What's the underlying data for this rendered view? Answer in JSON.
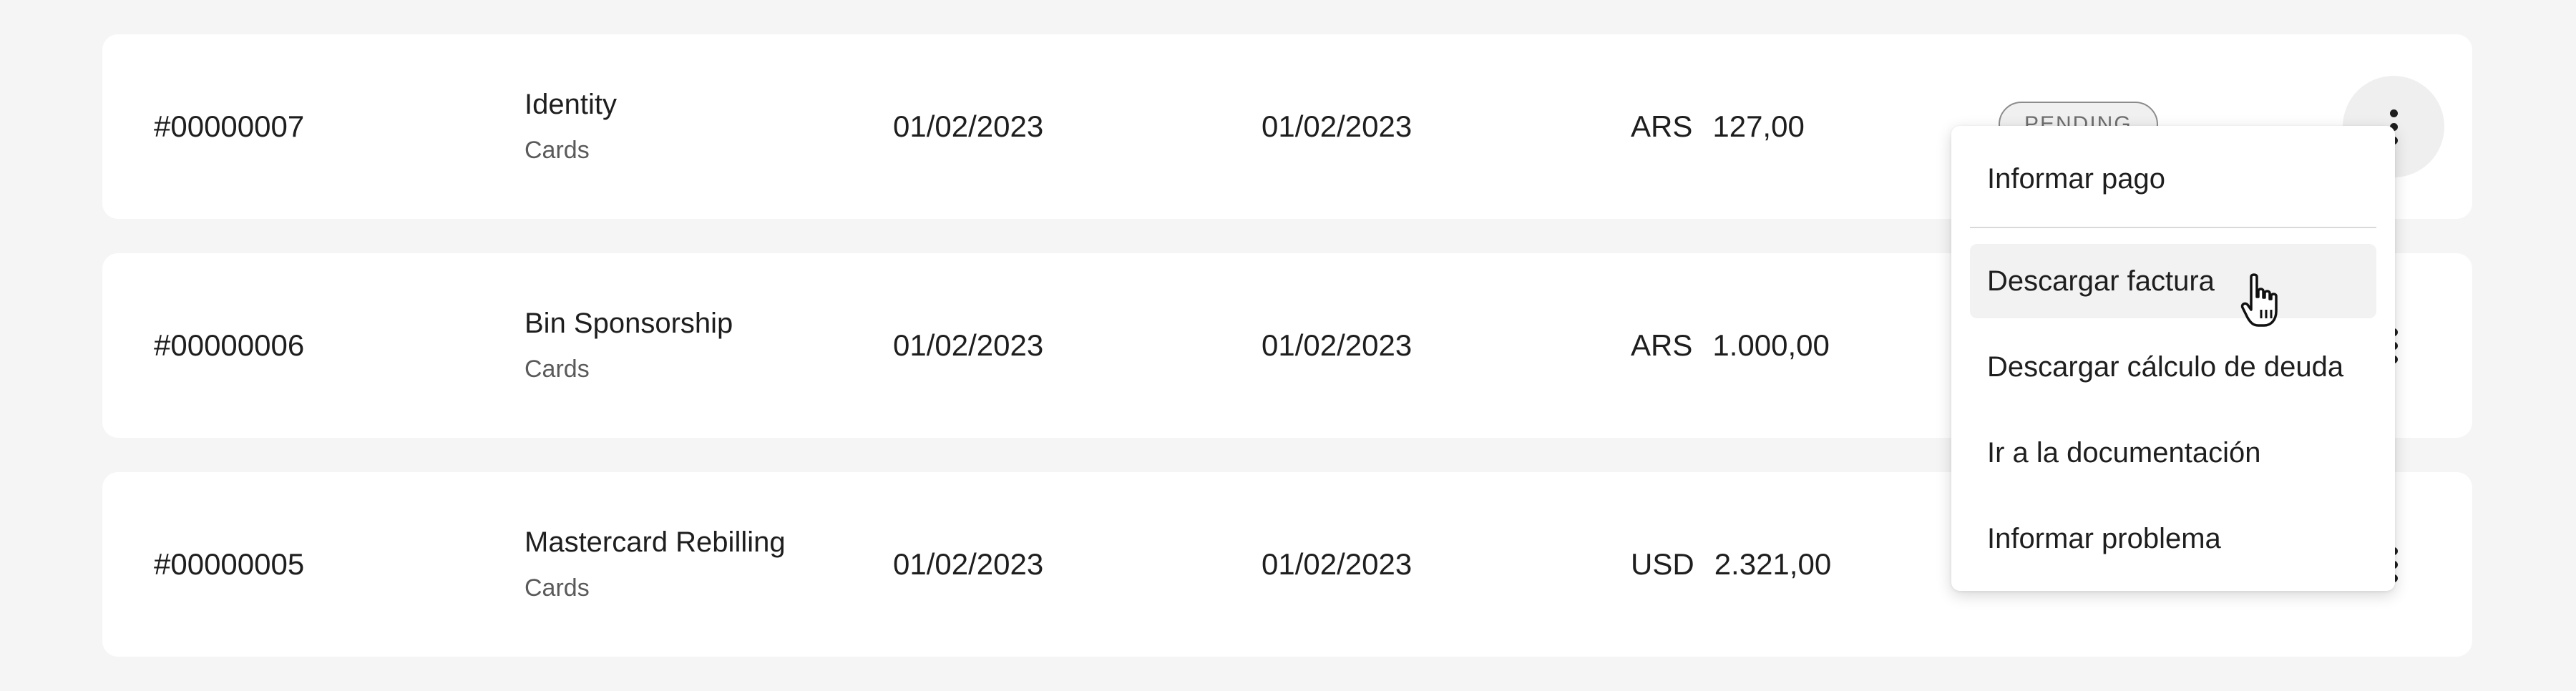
{
  "invoices": [
    {
      "number": "#00000007",
      "name": "Identity",
      "category": "Cards",
      "date_issued": "01/02/2023",
      "date_due": "01/02/2023",
      "currency": "ARS",
      "amount": "127,00",
      "status": "PENDING"
    },
    {
      "number": "#00000006",
      "name": "Bin Sponsorship",
      "category": "Cards",
      "date_issued": "01/02/2023",
      "date_due": "01/02/2023",
      "currency": "ARS",
      "amount": "1.000,00"
    },
    {
      "number": "#00000005",
      "name": "Mastercard Rebilling",
      "category": "Cards",
      "date_issued": "01/02/2023",
      "date_due": "01/02/2023",
      "currency": "USD",
      "amount": "2.321,00"
    }
  ],
  "menu": {
    "items": [
      {
        "label": "Informar pago"
      },
      {
        "label": "Descargar factura"
      },
      {
        "label": "Descargar cálculo de deuda"
      },
      {
        "label": "Ir a la documentación"
      },
      {
        "label": "Informar problema"
      }
    ],
    "hovered_item": "Descargar factura"
  },
  "icons": {
    "row_actions": "kebab-menu-icon",
    "cursor": "hand-pointer-icon"
  },
  "colors": {
    "background": "#f5f5f5",
    "card": "#ffffff",
    "text": "#1e1e1e",
    "muted_text": "#5a5a5a",
    "badge_border": "#8c8c8c",
    "menu_hover": "#f2f2f2"
  }
}
